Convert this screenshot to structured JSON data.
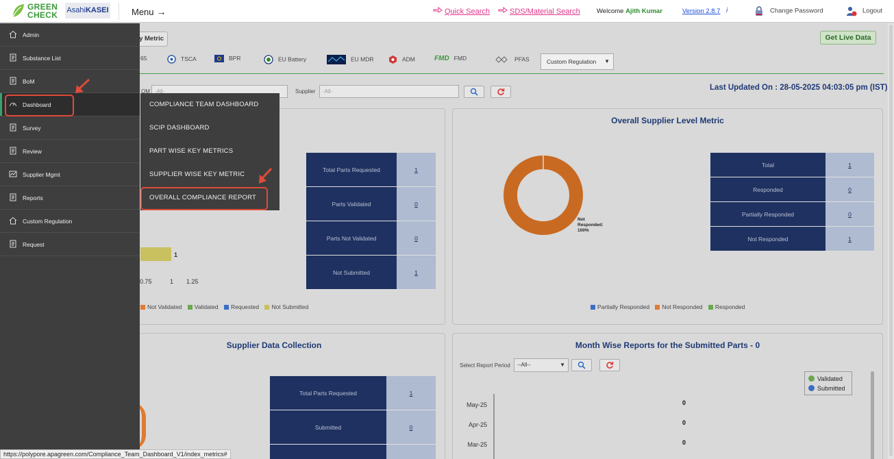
{
  "brand": {
    "logo_line1": "GREEN",
    "logo_line2": "CHECK",
    "asahi_pre": "Asahi",
    "asahi_bold": "KASEI"
  },
  "header": {
    "menu_label": "Menu",
    "menu_arrow": "→",
    "quick_search": "Quick Search",
    "sds_search": "SDS/Material Search",
    "welcome_prefix": "Welcome",
    "user_name": "Ajith Kumar",
    "version": "Version 2.8.7",
    "info_glyph": "i",
    "change_password": "Change Password",
    "logout": "Logout"
  },
  "sidebar": {
    "items": [
      {
        "label": "Admin",
        "icon": "home-icon"
      },
      {
        "label": "Substance List",
        "icon": "document-icon"
      },
      {
        "label": "BoM",
        "icon": "document-icon"
      },
      {
        "label": "Dashboard",
        "icon": "gauge-icon"
      },
      {
        "label": "Survey",
        "icon": "document-icon"
      },
      {
        "label": "Review",
        "icon": "document-icon"
      },
      {
        "label": "Supplier Mgmt",
        "icon": "chart-icon"
      },
      {
        "label": "Reports",
        "icon": "document-icon"
      },
      {
        "label": "Custom Regulation",
        "icon": "home-icon"
      },
      {
        "label": "Request",
        "icon": "document-icon"
      }
    ],
    "active": "Dashboard"
  },
  "dashboard_menu": {
    "items": [
      "COMPLIANCE TEAM DASHBOARD",
      "SCIP DASHBOARD",
      "PART WISE KEY METRICS",
      "SUPPLIER WISE KEY METRIC",
      "OVERALL COMPLIANCE REPORT"
    ],
    "highlighted": "OVERALL COMPLIANCE REPORT"
  },
  "toolbar": {
    "key_metric_btn": "y Metric",
    "live_btn": "Get Live Data"
  },
  "regulations": [
    {
      "label": "65",
      "icon": "prop65-icon"
    },
    {
      "label": "TSCA",
      "icon": "tsca-icon"
    },
    {
      "label": "BPR",
      "icon": "bpr-icon"
    },
    {
      "label": "EU Battery",
      "icon": "eu-battery-icon"
    },
    {
      "label": "EU MDR",
      "icon": "eu-mdr-icon"
    },
    {
      "label": "ADM",
      "icon": "adm-icon"
    },
    {
      "label": "FMD",
      "icon": "fmd-icon",
      "badge": "FMD"
    },
    {
      "label": "PFAS",
      "icon": "pfas-icon",
      "badge": "PFAS"
    }
  ],
  "custom_regulation_select": "Custom Regulation",
  "filters": {
    "bom_label": "OM",
    "bom_placeholder": "-All-",
    "supplier_label": "Supplier",
    "supplier_placeholder": "-All-"
  },
  "last_updated": "Last Updated On : 28-05-2025 04:03:05 pm (IST)",
  "part_metric": {
    "rows": [
      {
        "label": "Total Parts Requested",
        "value": "1"
      },
      {
        "label": "Parts Validated",
        "value": "0"
      },
      {
        "label": "Parts Not Validated",
        "value": "0"
      },
      {
        "label": "Not Submitted",
        "value": "1"
      }
    ],
    "bar_value_label": "1",
    "x_ticks": [
      "0.75",
      "1",
      "1.25"
    ],
    "legend": [
      {
        "label": "Not Validated",
        "color": "#e07b30"
      },
      {
        "label": "Validated",
        "color": "#6aa84f"
      },
      {
        "label": "Requested",
        "color": "#3a6fc4"
      },
      {
        "label": "Not Submitted",
        "color": "#c9c060"
      }
    ]
  },
  "supplier_metric": {
    "title": "Overall Supplier Level Metric",
    "donut_label_line1": "Not",
    "donut_label_line2": "Responded:",
    "donut_label_line3": "100%",
    "rows": [
      {
        "label": "Total",
        "value": "1"
      },
      {
        "label": "Responded",
        "value": "0"
      },
      {
        "label": "Partially Responded",
        "value": "0"
      },
      {
        "label": "Not Responded",
        "value": "1"
      }
    ],
    "legend": [
      {
        "label": "Partially Responded",
        "color": "#3a6fc4"
      },
      {
        "label": "Not Responded",
        "color": "#e07b30"
      },
      {
        "label": "Responded",
        "color": "#6aa84f"
      }
    ]
  },
  "supplier_collection": {
    "title": "Supplier Data Collection",
    "rows": [
      {
        "label": "Total Parts Requested",
        "value": "1"
      },
      {
        "label": "Submitted",
        "value": "0"
      }
    ]
  },
  "month_reports": {
    "title": "Month Wise Reports for the Submitted Parts - 0",
    "period_label": "Select Report Period",
    "period_value": "--All--",
    "legend": [
      {
        "label": "Validated",
        "color": "#6aa84f"
      },
      {
        "label": "Submitted",
        "color": "#3a6fc4"
      }
    ]
  },
  "chart_data": {
    "type": "bar",
    "categories": [
      "May-25",
      "Apr-25",
      "Mar-25"
    ],
    "series": [
      {
        "name": "Validated",
        "values": [
          0,
          0,
          0
        ]
      },
      {
        "name": "Submitted",
        "values": [
          0,
          0,
          0
        ]
      }
    ],
    "value_labels": [
      "0",
      "0",
      "0"
    ]
  },
  "statusbar_url": "https://polypore.apagreen.com/Compliance_Team_Dashboard_V1/index_metrics#"
}
